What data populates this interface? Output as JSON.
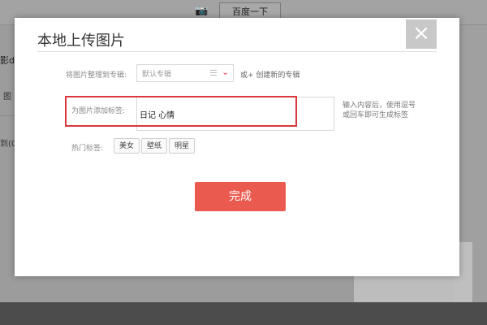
{
  "background": {
    "search_button": "百度一下",
    "left_fragment_1": "影d",
    "left_fragment_2": "图",
    "left_fragment_3": "到(0"
  },
  "dialog": {
    "title": "本地上传图片",
    "close_label": "×",
    "album": {
      "label": "将图片整理到专辑:",
      "selected": "默认专辑",
      "create_link": "或+ 创建新的专辑"
    },
    "tags": {
      "label": "为图片添加标签:",
      "value": "日记 心情",
      "hint": "输入内容后，使用逗号或回车即可生成标签"
    },
    "hot_tags": {
      "label": "热门标签:",
      "items": [
        "美女",
        "壁纸",
        "明星"
      ]
    },
    "done_button": "完成"
  },
  "colors": {
    "accent": "#ea5a4f",
    "highlight": "#d9363e"
  }
}
